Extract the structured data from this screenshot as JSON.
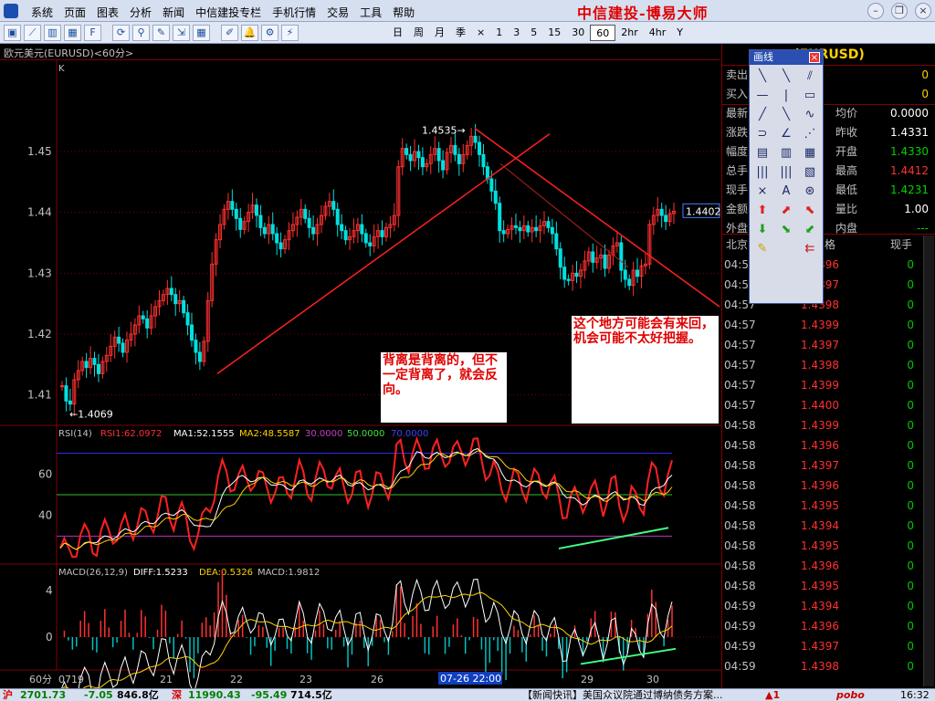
{
  "menu": {
    "items": [
      "系统",
      "页面",
      "图表",
      "分析",
      "新闻",
      "中信建投专栏",
      "手机行情",
      "交易",
      "工具",
      "帮助"
    ],
    "brand": "中信建投-博易大师"
  },
  "toolbar": {
    "icons": [
      "window-icon",
      "line-chart-icon",
      "bar-chart-icon",
      "table-icon",
      "f10-icon",
      "refresh-icon",
      "zoom-icon",
      "draw-icon",
      "export-icon",
      "grid-icon",
      "pen-icon",
      "alarm-icon",
      "tools-icon",
      "flash-icon"
    ],
    "periods": [
      "日",
      "周",
      "月",
      "季",
      "×",
      "1",
      "3",
      "5",
      "15",
      "30",
      "60",
      "2hr",
      "4hr",
      "Y"
    ],
    "active_period": "60"
  },
  "chart": {
    "title": "欧元美元(EURUSD)<60分>",
    "k_label": "K",
    "main_y_ticks": [
      "1.45",
      "1.44",
      "1.43",
      "1.42",
      "1.41"
    ],
    "high_label": "1.4535",
    "low_label": "1.4069",
    "current_price_tag": "1.4402",
    "annotation_1": "背离是背离的，但不一定背离了，就会反向。",
    "annotation_2": "这个地方可能会有来回，机会可能不太好把握。",
    "rsi_legend": {
      "name": "RSI(14)",
      "rsi1": "RSI1:62.0972",
      "ma1": "MA1:52.1555",
      "ma2": "MA2:48.5587",
      "l30": "30.0000",
      "l50": "50.0000",
      "l70": "70.0000"
    },
    "rsi_y_ticks": [
      "60",
      "40"
    ],
    "macd_legend": {
      "name": "MACD(26,12,9)",
      "diff": "DIFF:1.5233",
      "dea": "DEA:0.5326",
      "macd": "MACD:1.9812"
    },
    "macd_y_ticks": [
      "4",
      "0"
    ],
    "period_label": "60分",
    "x_labels": [
      "0719",
      "21",
      "22",
      "23",
      "26",
      "28",
      "29",
      "30"
    ],
    "cursor_time": "07-26 22:00"
  },
  "quote": {
    "title": "(EURUSD)",
    "rows": [
      {
        "label": "卖出",
        "value": "0"
      },
      {
        "label": "买入",
        "value": "0"
      }
    ],
    "stats_left": [
      {
        "label": "最新"
      },
      {
        "label": "涨跌"
      },
      {
        "label": "幅度"
      },
      {
        "label": "总手"
      },
      {
        "label": "现手"
      },
      {
        "label": "金额"
      },
      {
        "label": "外盘"
      }
    ],
    "stats_right": [
      {
        "label": "均价",
        "value": "0.0000",
        "color": "#ffffff"
      },
      {
        "label": "昨收",
        "value": "1.4331",
        "color": "#ffffff"
      },
      {
        "label": "开盘",
        "value": "1.4330",
        "color": "#00d000"
      },
      {
        "label": "最高",
        "value": "1.4412",
        "color": "#ff3030"
      },
      {
        "label": "最低",
        "value": "1.4231",
        "color": "#00d000"
      },
      {
        "label": "量比",
        "value": "1.00",
        "color": "#ffffff"
      },
      {
        "label": "内盘",
        "value": "---",
        "color": "#00d000"
      }
    ],
    "tick_header": {
      "time": "北京",
      "price": "格",
      "vol": "现手"
    },
    "ticks": [
      {
        "t": "04:57",
        "p": "1.4396",
        "v": "0",
        "c": "#ff3030"
      },
      {
        "t": "04:57",
        "p": "1.4397",
        "v": "0",
        "c": "#ff3030"
      },
      {
        "t": "04:57",
        "p": "1.4398",
        "v": "0",
        "c": "#ff3030"
      },
      {
        "t": "04:57",
        "p": "1.4399",
        "v": "0",
        "c": "#ff3030"
      },
      {
        "t": "04:57",
        "p": "1.4397",
        "v": "0",
        "c": "#ff3030"
      },
      {
        "t": "04:57",
        "p": "1.4398",
        "v": "0",
        "c": "#ff3030"
      },
      {
        "t": "04:57",
        "p": "1.4399",
        "v": "0",
        "c": "#ff3030"
      },
      {
        "t": "04:57",
        "p": "1.4400",
        "v": "0",
        "c": "#ff3030"
      },
      {
        "t": "04:58",
        "p": "1.4399",
        "v": "0",
        "c": "#ff3030"
      },
      {
        "t": "04:58",
        "p": "1.4396",
        "v": "0",
        "c": "#ff3030"
      },
      {
        "t": "04:58",
        "p": "1.4397",
        "v": "0",
        "c": "#ff3030"
      },
      {
        "t": "04:58",
        "p": "1.4396",
        "v": "0",
        "c": "#ff3030"
      },
      {
        "t": "04:58",
        "p": "1.4395",
        "v": "0",
        "c": "#ff3030"
      },
      {
        "t": "04:58",
        "p": "1.4394",
        "v": "0",
        "c": "#ff3030"
      },
      {
        "t": "04:58",
        "p": "1.4395",
        "v": "0",
        "c": "#ff3030"
      },
      {
        "t": "04:58",
        "p": "1.4396",
        "v": "0",
        "c": "#ff3030"
      },
      {
        "t": "04:58",
        "p": "1.4395",
        "v": "0",
        "c": "#ff3030"
      },
      {
        "t": "04:59",
        "p": "1.4394",
        "v": "0",
        "c": "#ff3030"
      },
      {
        "t": "04:59",
        "p": "1.4396",
        "v": "0",
        "c": "#ff3030"
      },
      {
        "t": "04:59",
        "p": "1.4397",
        "v": "0",
        "c": "#ff3030"
      },
      {
        "t": "04:59",
        "p": "1.4398",
        "v": "0",
        "c": "#ff3030"
      }
    ]
  },
  "palette": {
    "title": "画线",
    "close": "×",
    "tools": [
      "line-icon",
      "ray-icon",
      "parallel-icon",
      "hline-icon",
      "vline-icon",
      "rect-icon",
      "segment-icon",
      "arrow-line-icon",
      "wave-icon",
      "arc-icon",
      "angle-icon",
      "fan-icon",
      "channel-icon",
      "fibonacci-icon",
      "gann-icon",
      "cycle-icon",
      "period-icon",
      "golden-icon",
      "resist-icon",
      "text-icon",
      "help-icon",
      "up-arrow-icon",
      "upright-arrow-icon",
      "upleft-arrow-icon",
      "down-arrow-icon",
      "downright-arrow-icon",
      "downleft-arrow-icon",
      "eraser-icon",
      "blank",
      "delete-icon"
    ],
    "glyphs": [
      "╲",
      "╲",
      "⫽",
      "—",
      "|",
      "▭",
      "╱",
      "╲",
      "∿",
      "⊃",
      "∠",
      "⋰",
      "▤",
      "▥",
      "▦",
      "|||",
      "|||",
      "▧",
      "⨯",
      "A",
      "⊛",
      "⬆",
      "⬈",
      "⬉",
      "⬇",
      "⬊",
      "⬋",
      "✎",
      "",
      "⇇"
    ]
  },
  "status": {
    "sh_label": "沪",
    "sh_index": "2701.73",
    "sh_change": "-7.05",
    "sh_amount": "846.8亿",
    "sz_label": "深",
    "sz_index": "11990.43",
    "sz_change": "-95.49",
    "sz_amount": "714.5亿",
    "news": "【新闻快讯】美国众议院通过博纳债务方案...",
    "alert": "▲1",
    "logo": "pobo",
    "time": "16:32"
  },
  "chart_data": {
    "type": "candlestick",
    "price_range": [
      1.405,
      1.465
    ],
    "candles": [
      1.4115,
      1.409,
      1.4085,
      1.4125,
      1.414,
      1.4155,
      1.4145,
      1.416,
      1.415,
      1.4135,
      1.4155,
      1.4165,
      1.418,
      1.4195,
      1.4185,
      1.417,
      1.419,
      1.42,
      1.4215,
      1.423,
      1.4225,
      1.421,
      1.423,
      1.4245,
      1.4255,
      1.4265,
      1.4275,
      1.4265,
      1.425,
      1.4255,
      1.4235,
      1.4215,
      1.419,
      1.417,
      1.4155,
      1.4188,
      1.4255,
      1.4315,
      1.4355,
      1.438,
      1.4405,
      1.4418,
      1.4405,
      1.439,
      1.4372,
      1.4385,
      1.44,
      1.4412,
      1.4395,
      1.4375,
      1.4365,
      1.438,
      1.4365,
      1.435,
      1.434,
      1.4355,
      1.437,
      1.438,
      1.4392,
      1.4405,
      1.439,
      1.4375,
      1.4365,
      1.438,
      1.4395,
      1.441,
      1.4418,
      1.4405,
      1.438,
      1.437,
      1.4355,
      1.436,
      1.437,
      1.438,
      1.4365,
      1.435,
      1.4345,
      1.436,
      1.437,
      1.436,
      1.4375,
      1.438,
      1.4395,
      1.4475,
      1.4505,
      1.4495,
      1.4485,
      1.45,
      1.449,
      1.4475,
      1.448,
      1.4495,
      1.4505,
      1.4485,
      1.447,
      1.4498,
      1.451,
      1.4495,
      1.448,
      1.4495,
      1.451,
      1.4525,
      1.4515,
      1.4495,
      1.4475,
      1.4455,
      1.4435,
      1.4415,
      1.437,
      1.4365,
      1.4372,
      1.4378,
      1.4375,
      1.437,
      1.4378,
      1.4368,
      1.4375,
      1.437,
      1.4378,
      1.4385,
      1.4375,
      1.4365,
      1.434,
      1.431,
      1.429,
      1.4288,
      1.43,
      1.4295,
      1.4305,
      1.432,
      1.4335,
      1.4318,
      1.4325,
      1.433,
      1.4308,
      1.433,
      1.4345,
      1.435,
      1.4305,
      1.429,
      1.428,
      1.4305,
      1.4295,
      1.4312,
      1.4315,
      1.438,
      1.4395,
      1.4405,
      1.4395,
      1.4385,
      1.4398,
      1.4402
    ],
    "high": 1.4535,
    "low": 1.4069,
    "last": 1.4402
  }
}
